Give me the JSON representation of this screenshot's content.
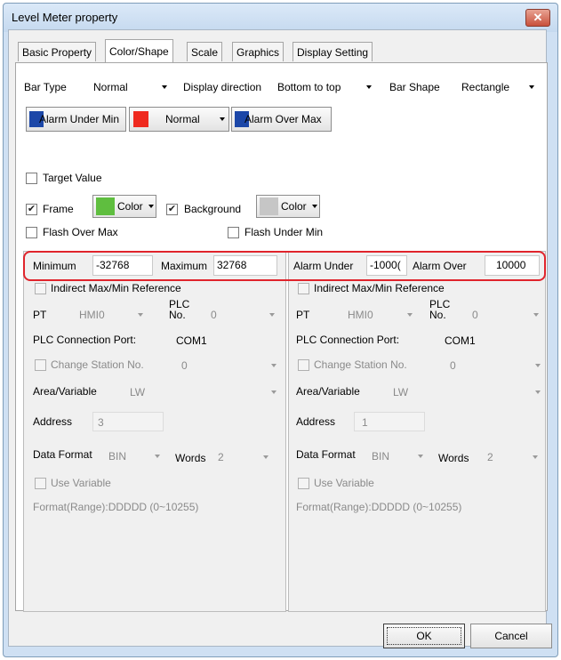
{
  "window": {
    "title": "Level Meter property",
    "close_label": "✕"
  },
  "tabs": [
    {
      "label": "Basic Property"
    },
    {
      "label": "Color/Shape"
    },
    {
      "label": "Scale"
    },
    {
      "label": "Graphics"
    },
    {
      "label": "Display Setting"
    }
  ],
  "bar": {
    "type_label": "Bar Type",
    "type_value": "Normal",
    "direction_label": "Display direction",
    "direction_value": "Bottom to top",
    "shape_label": "Bar Shape",
    "shape_value": "Rectangle"
  },
  "color_buttons": {
    "alarm_under_min": "Alarm Under Min",
    "normal": "Normal",
    "alarm_over_max": "Alarm Over Max",
    "alarm_under_color": "#1c47a8",
    "normal_color": "#ef2a1f",
    "alarm_over_color": "#1c47a8"
  },
  "options": {
    "target_value": "Target Value",
    "frame": "Frame",
    "frame_color": "#5fbe3f",
    "color_button": "Color",
    "background": "Background",
    "background_color": "#c6c6c6",
    "flash_over_max": "Flash Over Max",
    "flash_under_min": "Flash Under Min"
  },
  "range": {
    "minimum_label": "Minimum",
    "minimum_value": "-32768",
    "maximum_label": "Maximum",
    "maximum_value": "32768",
    "alarm_under_label": "Alarm Under",
    "alarm_under_value": "-1000(",
    "alarm_over_label": "Alarm Over",
    "alarm_over_value": "10000"
  },
  "left": {
    "indirect": "Indirect Max/Min Reference",
    "pt_label": "PT",
    "pt_value": "HMI0",
    "plc_no_label": "PLC No.",
    "plc_no_value": "0",
    "port_label": "PLC Connection Port:",
    "port_value": "COM1",
    "change_station": "Change Station No.",
    "station_value": "0",
    "area_label": "Area/Variable",
    "area_value": "LW",
    "address_label": "Address",
    "address_value": "3",
    "format_label": "Data Format",
    "format_value": "BIN",
    "words_label": "Words",
    "words_value": "2",
    "use_variable": "Use Variable",
    "range_format": "Format(Range):DDDDD (0~10255)"
  },
  "right": {
    "indirect": "Indirect Max/Min Reference",
    "pt_label": "PT",
    "pt_value": "HMI0",
    "plc_no_label": "PLC No.",
    "plc_no_value": "0",
    "port_label": "PLC Connection Port:",
    "port_value": "COM1",
    "change_station": "Change Station No.",
    "station_value": "0",
    "area_label": "Area/Variable",
    "area_value": "LW",
    "address_label": "Address",
    "address_value": "1",
    "format_label": "Data Format",
    "format_value": "BIN",
    "words_label": "Words",
    "words_value": "2",
    "use_variable": "Use Variable",
    "range_format": "Format(Range):DDDDD (0~10255)"
  },
  "footer": {
    "ok": "OK",
    "cancel": "Cancel"
  }
}
